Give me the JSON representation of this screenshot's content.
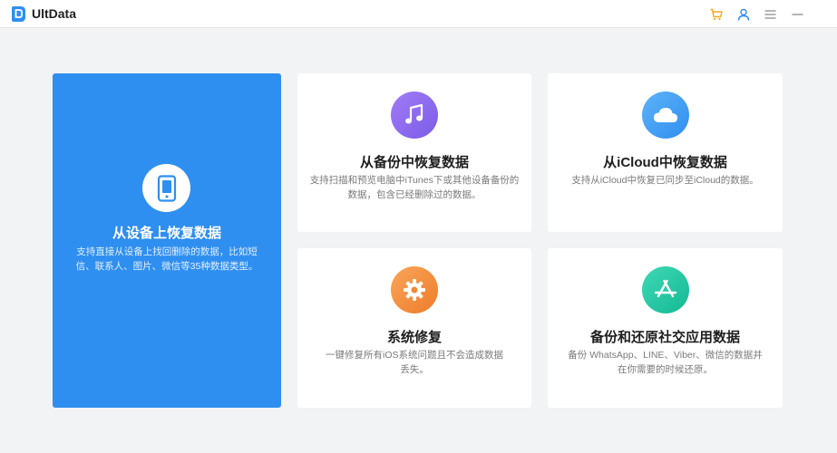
{
  "app": {
    "title": "UltData",
    "icons": [
      "cart-icon",
      "user-icon",
      "menu-icon",
      "minimize-icon"
    ]
  },
  "colors": {
    "accent": "#2f8ff0",
    "music": "#8a6cf0",
    "cloud": "#3d9bf2",
    "repair": "#f2893a",
    "appstore": "#23c9a5"
  },
  "cards": [
    {
      "title": "从设备上恢复数据",
      "desc": "支持直接从设备上找回删除的数据，比如短信、联系人、图片、微信等35种数据类型。",
      "icon": "phone-icon"
    },
    {
      "title": "从备份中恢复数据",
      "desc": "支持扫描和预览电脑中iTunes下或其他设备备份的数据，包含已经删除过的数据。",
      "icon": "music-note-icon"
    },
    {
      "title": "从iCloud中恢复数据",
      "desc": "支持从iCloud中恢复已同步至iCloud的数据。",
      "icon": "cloud-icon"
    },
    {
      "title": "系统修复",
      "desc": "一键修复所有iOS系统问题且不会造成数据丢失。",
      "icon": "gear-icon"
    },
    {
      "title": "备份和还原社交应用数据",
      "desc": "备份 WhatsApp、LINE、Viber、微信的数据并在你需要的时候还原。",
      "icon": "app-store-icon"
    }
  ]
}
